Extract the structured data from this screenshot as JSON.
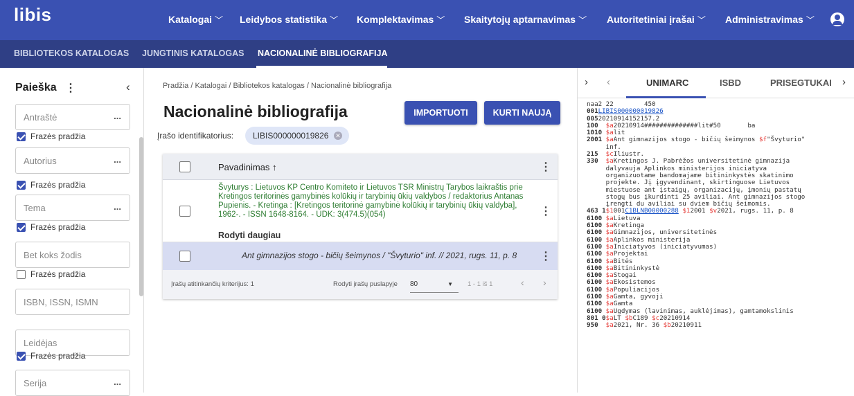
{
  "app": {
    "logo": "libis",
    "user_icon": "account-circle-icon"
  },
  "nav": [
    {
      "label": "Katalogai"
    },
    {
      "label": "Leidybos statistika"
    },
    {
      "label": "Komplektavimas"
    },
    {
      "label": "Skaitytojų aptarnavimas"
    },
    {
      "label": "Autoritetiniai įrašai"
    },
    {
      "label": "Administravimas"
    }
  ],
  "subnav": [
    {
      "label": "BIBLIOTEKOS KATALOGAS"
    },
    {
      "label": "JUNGTINIS KATALOGAS"
    },
    {
      "label": "NACIONALINĖ BIBLIOGRAFIJA"
    }
  ],
  "sidebar": {
    "title": "Paieška",
    "fields": [
      {
        "placeholder": "Antraštė",
        "more": "...",
        "checkbox": "Frazės pradžia",
        "checked": true
      },
      {
        "placeholder": "Autorius",
        "more": "...",
        "checkbox": "Frazės pradžia",
        "checked": true
      },
      {
        "placeholder": "Tema",
        "more": "...",
        "checkbox": "Frazės pradžia",
        "checked": true
      },
      {
        "placeholder": "Bet koks žodis",
        "more": "",
        "checkbox": "Frazės pradžia",
        "checked": false
      },
      {
        "placeholder": "ISBN, ISSN, ISMN",
        "more": "",
        "checkbox": "",
        "checked": false
      },
      {
        "placeholder": "Leidėjas",
        "more": "",
        "checkbox": "Frazės pradžia",
        "checked": true
      },
      {
        "placeholder": "Serija",
        "more": "...",
        "checkbox": "",
        "checked": false
      }
    ]
  },
  "main": {
    "breadcrumb": "Pradžia / Katalogai / Bibliotekos katalogas / Nacionalinė bibliografija",
    "title": "Nacionalinė bibliografija",
    "import_label": "IMPORTUOTI",
    "create_label": "KURTI NAUJĄ",
    "id_label": "Įrašo identifikatorius:",
    "id_value": "LIBIS000000019826",
    "table": {
      "header": "Pavadinimas ↑",
      "row1_text": "Švyturys : Lietuvos KP Centro Komiteto ir Lietuvos TSR Ministrų Tarybos laikraštis prie Kretingos teritorinės gamybinės kolūkių ir tarybinių ūkių valdybos / redaktorius Antanas Pupienis. - Kretinga : [Kretingos teritorinė gamybinė kolūkių ir tarybinių ūkių valdyba], 1962-. - ISSN 1648-8164. - UDK: 3(474.5)(054)",
      "row1_more": "Rodyti daugiau",
      "row2_text": "Ant gimnazijos stogo - bičių šeimynos / \"Švyturio\" inf. // 2021, rugs. 11, p. 8",
      "footer_count": "Įrašų atitinkančių kriterijus: 1",
      "footer_per_page_label": "Rodyti įrašų puslapyje",
      "footer_per_page": "80",
      "footer_range": "1 - 1 iš 1"
    }
  },
  "panel": {
    "tabs": [
      "UNIMARC",
      "ISBD",
      "PRISEGTUKAI"
    ],
    "active_tab": "UNIMARC",
    "marc": [
      [
        {
          "c": "",
          "v": "naa2 22        450 "
        }
      ],
      [
        {
          "c": "t",
          "v": "001"
        },
        {
          "c": "l",
          "v": "LIBIS000000019826"
        }
      ],
      [
        {
          "c": "t",
          "v": "005"
        },
        {
          "c": "",
          "v": "20210914152157.2"
        }
      ],
      [
        {
          "c": "t",
          "v": "100  "
        },
        {
          "c": "s",
          "v": "$a"
        },
        {
          "c": "",
          "v": "20210914##############lit#50       ba"
        }
      ],
      [
        {
          "c": "t",
          "v": "1010 "
        },
        {
          "c": "s",
          "v": "$a"
        },
        {
          "c": "",
          "v": "lit"
        }
      ],
      [
        {
          "c": "t",
          "v": "2001 "
        },
        {
          "c": "s",
          "v": "$a"
        },
        {
          "c": "",
          "v": "Ant gimnazijos stogo - bičių šeimynos "
        },
        {
          "c": "s",
          "v": "$f"
        },
        {
          "c": "",
          "v": "\"Švyturio\""
        }
      ],
      [
        {
          "c": "",
          "v": "     inf."
        }
      ],
      [
        {
          "c": "t",
          "v": "215  "
        },
        {
          "c": "s",
          "v": "$c"
        },
        {
          "c": "",
          "v": "Iliustr."
        }
      ],
      [
        {
          "c": "t",
          "v": "330  "
        },
        {
          "c": "s",
          "v": "$a"
        },
        {
          "c": "",
          "v": "Kretingos J. Pabrėžos universitetinė gimnazija"
        }
      ],
      [
        {
          "c": "",
          "v": "     dalyvauja Aplinkos ministerijos iniciatyva"
        }
      ],
      [
        {
          "c": "",
          "v": "     organizuotame bandomajame bitininkystės skatinimo"
        }
      ],
      [
        {
          "c": "",
          "v": "     projekte. Jį įgyvendinant, skirtinguose Lietuvos"
        }
      ],
      [
        {
          "c": "",
          "v": "     miestuose ant įstaigų, organizacijų, įmonių pastatų"
        }
      ],
      [
        {
          "c": "",
          "v": "     stogų bus įkurdinti 25 aviliai. Ant gimnazijos stogo"
        }
      ],
      [
        {
          "c": "",
          "v": "     įrengti du aviliai su dviem bičių šeimomis."
        }
      ],
      [
        {
          "c": "t",
          "v": "463 1"
        },
        {
          "c": "s",
          "v": "$1"
        },
        {
          "c": "",
          "v": "001"
        },
        {
          "c": "l",
          "v": "C1BLNB00000288"
        },
        {
          "c": "",
          "v": " "
        },
        {
          "c": "s",
          "v": "$1"
        },
        {
          "c": "",
          "v": "2001 "
        },
        {
          "c": "s",
          "v": "$v"
        },
        {
          "c": "",
          "v": "2021, rugs. 11, p. 8"
        }
      ],
      [
        {
          "c": "t",
          "v": "6100 "
        },
        {
          "c": "s",
          "v": "$a"
        },
        {
          "c": "",
          "v": "Lietuva"
        }
      ],
      [
        {
          "c": "t",
          "v": "6100 "
        },
        {
          "c": "s",
          "v": "$a"
        },
        {
          "c": "",
          "v": "Kretinga"
        }
      ],
      [
        {
          "c": "t",
          "v": "6100 "
        },
        {
          "c": "s",
          "v": "$a"
        },
        {
          "c": "",
          "v": "Gimnazijos, universitetinės"
        }
      ],
      [
        {
          "c": "t",
          "v": "6100 "
        },
        {
          "c": "s",
          "v": "$a"
        },
        {
          "c": "",
          "v": "Aplinkos ministerija"
        }
      ],
      [
        {
          "c": "t",
          "v": "6100 "
        },
        {
          "c": "s",
          "v": "$a"
        },
        {
          "c": "",
          "v": "Iniciatyvos (iniciatyvumas)"
        }
      ],
      [
        {
          "c": "t",
          "v": "6100 "
        },
        {
          "c": "s",
          "v": "$a"
        },
        {
          "c": "",
          "v": "Projektai"
        }
      ],
      [
        {
          "c": "t",
          "v": "6100 "
        },
        {
          "c": "s",
          "v": "$a"
        },
        {
          "c": "",
          "v": "Bitės"
        }
      ],
      [
        {
          "c": "t",
          "v": "6100 "
        },
        {
          "c": "s",
          "v": "$a"
        },
        {
          "c": "",
          "v": "Bitininkystė"
        }
      ],
      [
        {
          "c": "t",
          "v": "6100 "
        },
        {
          "c": "s",
          "v": "$a"
        },
        {
          "c": "",
          "v": "Stogai"
        }
      ],
      [
        {
          "c": "t",
          "v": "6100 "
        },
        {
          "c": "s",
          "v": "$a"
        },
        {
          "c": "",
          "v": "Ekosistemos"
        }
      ],
      [
        {
          "c": "t",
          "v": "6100 "
        },
        {
          "c": "s",
          "v": "$a"
        },
        {
          "c": "",
          "v": "Populiacijos"
        }
      ],
      [
        {
          "c": "t",
          "v": "6100 "
        },
        {
          "c": "s",
          "v": "$a"
        },
        {
          "c": "",
          "v": "Gamta, gyvoji"
        }
      ],
      [
        {
          "c": "t",
          "v": "6100 "
        },
        {
          "c": "s",
          "v": "$a"
        },
        {
          "c": "",
          "v": "Gamta"
        }
      ],
      [
        {
          "c": "t",
          "v": "6100 "
        },
        {
          "c": "s",
          "v": "$a"
        },
        {
          "c": "",
          "v": "Ugdymas (lavinimas, auklėjimas), gamtamokslinis"
        }
      ],
      [
        {
          "c": "t",
          "v": "801 0"
        },
        {
          "c": "s",
          "v": "$a"
        },
        {
          "c": "",
          "v": "LT "
        },
        {
          "c": "s",
          "v": "$b"
        },
        {
          "c": "",
          "v": "C189 "
        },
        {
          "c": "s",
          "v": "$c"
        },
        {
          "c": "",
          "v": "20210914"
        }
      ],
      [
        {
          "c": "t",
          "v": "950  "
        },
        {
          "c": "s",
          "v": "$a"
        },
        {
          "c": "",
          "v": "2021, Nr. 36 "
        },
        {
          "c": "s",
          "v": "$b"
        },
        {
          "c": "",
          "v": "20210911"
        }
      ]
    ]
  },
  "colors": {
    "primary": "#3a51b2",
    "subnav": "#2f3f85",
    "subfield": "#e53935",
    "link": "#1a54c7",
    "record_green": "#2e7d32"
  }
}
